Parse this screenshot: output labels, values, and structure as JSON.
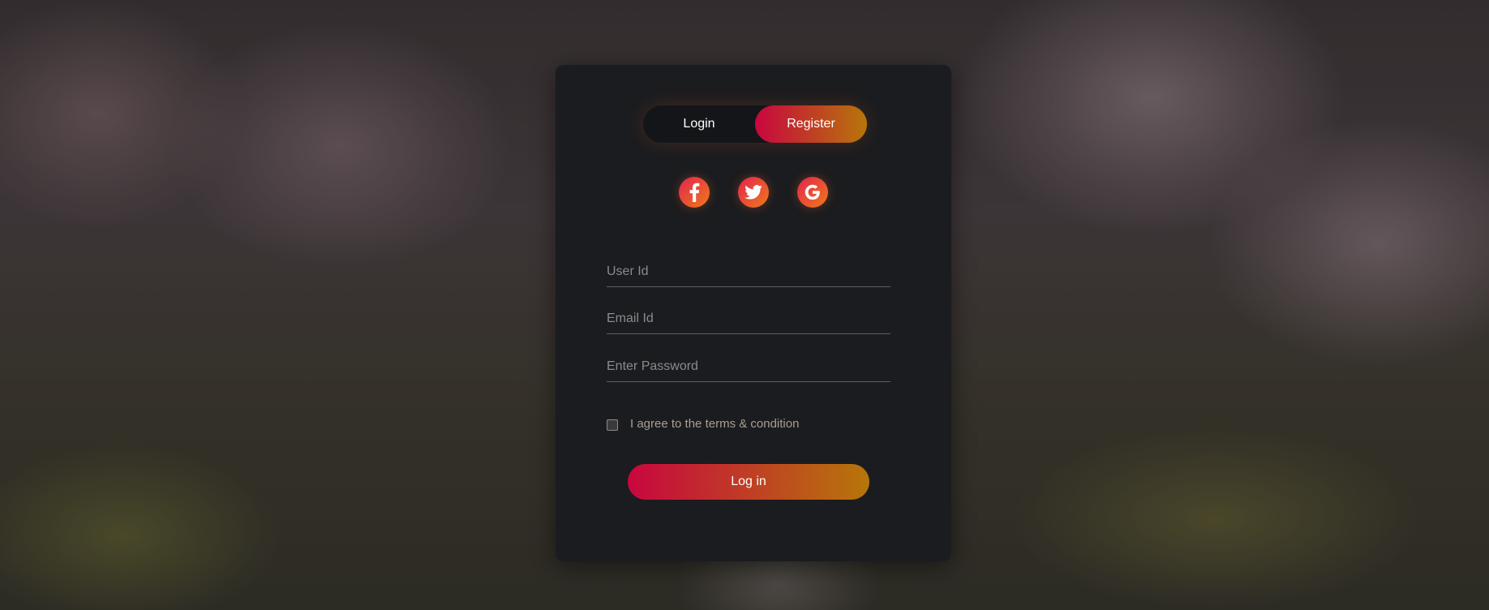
{
  "tabs": {
    "login_label": "Login",
    "register_label": "Register",
    "active": "Register"
  },
  "socials": [
    {
      "name": "facebook",
      "icon": "facebook-icon"
    },
    {
      "name": "twitter",
      "icon": "twitter-icon"
    },
    {
      "name": "google",
      "icon": "google-icon"
    }
  ],
  "form": {
    "user_id_placeholder": "User Id",
    "email_placeholder": "Email Id",
    "password_placeholder": "Enter Password",
    "agree_label": "I agree to the terms & condition",
    "agree_checked": false,
    "submit_label": "Log in"
  },
  "colors": {
    "card_background": "#1b1c1f",
    "gradient_start": "#c8063f",
    "gradient_end": "#b7760a",
    "social_gradient_start": "#e0244f",
    "social_gradient_end": "#f07a1a"
  }
}
